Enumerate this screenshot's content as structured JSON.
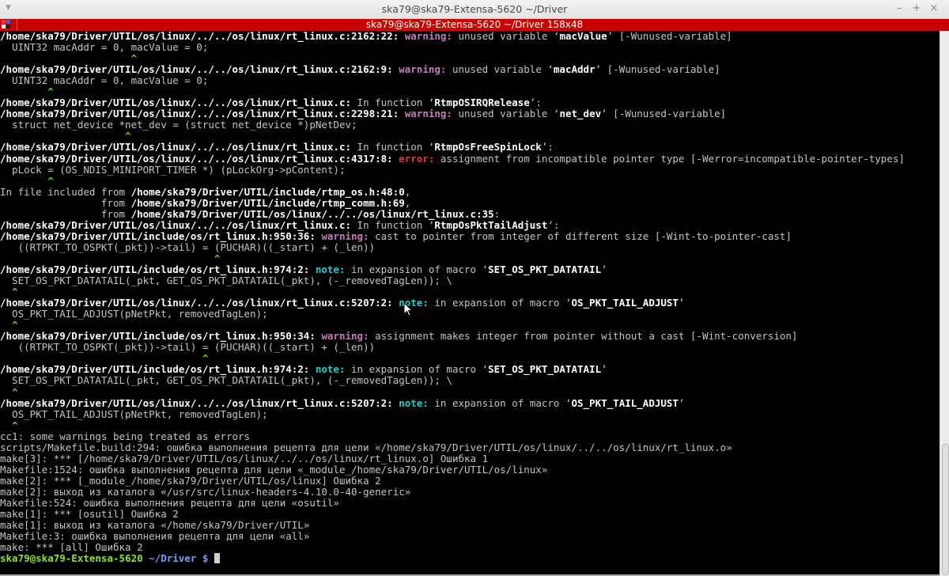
{
  "window": {
    "title": "ska79@ska79-Extensa-5620 ~/Driver",
    "controls": {
      "minimize": "–",
      "maximize": "+",
      "close": "×"
    },
    "menu_icon": "▼"
  },
  "tab": {
    "label": "ska79@ska79-Extensa-5620 ~/Driver 158x48"
  },
  "colors": {
    "tab_bar": "#c80000",
    "warning": "#c27fb7",
    "error": "#e83a3a",
    "note": "#2ccaca",
    "caret": "#6fcf18",
    "prompt_user": "#8ae234",
    "prompt_path": "#7b9ff0"
  },
  "terminal": {
    "lines": [
      [
        [
          "/home/ska79/Driver/UTIL/os/linux/../../os/linux/rt_linux.c:2162:22: ",
          "b"
        ],
        [
          "warning:",
          "w"
        ],
        [
          " unused variable ‘",
          "t"
        ],
        [
          "macValue",
          "b"
        ],
        [
          "’ [-Wunused-variable]",
          "t"
        ]
      ],
      [
        [
          "  UINT32 macAddr = 0, macValue = 0;",
          "t"
        ]
      ],
      [
        [
          "                      ^",
          "c"
        ]
      ],
      [
        [
          "/home/ska79/Driver/UTIL/os/linux/../../os/linux/rt_linux.c:2162:9: ",
          "b"
        ],
        [
          "warning:",
          "w"
        ],
        [
          " unused variable ‘",
          "t"
        ],
        [
          "macAddr",
          "b"
        ],
        [
          "’ [-Wunused-variable]",
          "t"
        ]
      ],
      [
        [
          "  UINT32 macAddr = 0, macValue = 0;",
          "t"
        ]
      ],
      [
        [
          "        ^",
          "c"
        ]
      ],
      [
        [
          "/home/ska79/Driver/UTIL/os/linux/../../os/linux/rt_linux.c:",
          "b"
        ],
        [
          " In function ‘",
          "t"
        ],
        [
          "RtmpOSIRQRelease",
          "b"
        ],
        [
          "’:",
          "t"
        ]
      ],
      [
        [
          "/home/ska79/Driver/UTIL/os/linux/../../os/linux/rt_linux.c:2298:21: ",
          "b"
        ],
        [
          "warning:",
          "w"
        ],
        [
          " unused variable ‘",
          "t"
        ],
        [
          "net_dev",
          "b"
        ],
        [
          "’ [-Wunused-variable]",
          "t"
        ]
      ],
      [
        [
          "  struct net_device *net_dev = (struct net_device *)pNetDev;",
          "t"
        ]
      ],
      [
        [
          "                     ^",
          "c"
        ]
      ],
      [
        [
          "/home/ska79/Driver/UTIL/os/linux/../../os/linux/rt_linux.c:",
          "b"
        ],
        [
          " In function ‘",
          "t"
        ],
        [
          "RtmpOsFreeSpinLock",
          "b"
        ],
        [
          "’:",
          "t"
        ]
      ],
      [
        [
          "/home/ska79/Driver/UTIL/os/linux/../../os/linux/rt_linux.c:4317:8: ",
          "b"
        ],
        [
          "error:",
          "e"
        ],
        [
          " assignment from incompatible pointer type [-Werror=incompatible-pointer-types]",
          "t"
        ]
      ],
      [
        [
          "  pLock = (OS_NDIS_MINIPORT_TIMER *) (pLockOrg->pContent);",
          "t"
        ]
      ],
      [
        [
          "        ^",
          "c"
        ]
      ],
      [
        [
          "In file included from ",
          "t"
        ],
        [
          "/home/ska79/Driver/UTIL/include/rtmp_os.h:48:0",
          "b"
        ],
        [
          ",",
          "t"
        ]
      ],
      [
        [
          "                 from ",
          "t"
        ],
        [
          "/home/ska79/Driver/UTIL/include/rtmp_comm.h:69",
          "b"
        ],
        [
          ",",
          "t"
        ]
      ],
      [
        [
          "                 from ",
          "t"
        ],
        [
          "/home/ska79/Driver/UTIL/os/linux/../../os/linux/rt_linux.c:35",
          "b"
        ],
        [
          ":",
          "t"
        ]
      ],
      [
        [
          "/home/ska79/Driver/UTIL/os/linux/../../os/linux/rt_linux.c:",
          "b"
        ],
        [
          " In function ‘",
          "t"
        ],
        [
          "RtmpOsPktTailAdjust",
          "b"
        ],
        [
          "’:",
          "t"
        ]
      ],
      [
        [
          "/home/ska79/Driver/UTIL/include/os/rt_linux.h:950:36: ",
          "b"
        ],
        [
          "warning:",
          "w"
        ],
        [
          " cast to pointer from integer of different size [-Wint-to-pointer-cast]",
          "t"
        ]
      ],
      [
        [
          "   ((RTPKT_TO_OSPKT(_pkt))->tail) = (PUCHAR)((_start) + (_len))",
          "t"
        ]
      ],
      [
        [
          "                                    ^",
          "c"
        ]
      ],
      [
        [
          "/home/ska79/Driver/UTIL/include/os/rt_linux.h:974:2: ",
          "b"
        ],
        [
          "note:",
          "n"
        ],
        [
          " in expansion of macro ‘",
          "t"
        ],
        [
          "SET_OS_PKT_DATATAIL",
          "b"
        ],
        [
          "’",
          "t"
        ]
      ],
      [
        [
          "  SET_OS_PKT_DATATAIL(_pkt, GET_OS_PKT_DATATAIL(_pkt), (-_removedTagLen)); \\",
          "t"
        ]
      ],
      [
        [
          "  ^",
          "c"
        ]
      ],
      [
        [
          "/home/ska79/Driver/UTIL/os/linux/../../os/linux/rt_linux.c:5207:2: ",
          "b"
        ],
        [
          "note:",
          "n"
        ],
        [
          " in expansion of macro ‘",
          "t"
        ],
        [
          "OS_PKT_TAIL_ADJUST",
          "b"
        ],
        [
          "’",
          "t"
        ]
      ],
      [
        [
          "  OS_PKT_TAIL_ADJUST(pNetPkt, removedTagLen);",
          "t"
        ]
      ],
      [
        [
          "  ^",
          "c"
        ]
      ],
      [
        [
          "/home/ska79/Driver/UTIL/include/os/rt_linux.h:950:34: ",
          "b"
        ],
        [
          "warning:",
          "w"
        ],
        [
          " assignment makes integer from pointer without a cast [-Wint-conversion]",
          "t"
        ]
      ],
      [
        [
          "   ((RTPKT_TO_OSPKT(_pkt))->tail) = (PUCHAR)((_start) + (_len))",
          "t"
        ]
      ],
      [
        [
          "                                  ^",
          "c"
        ]
      ],
      [
        [
          "/home/ska79/Driver/UTIL/include/os/rt_linux.h:974:2: ",
          "b"
        ],
        [
          "note:",
          "n"
        ],
        [
          " in expansion of macro ‘",
          "t"
        ],
        [
          "SET_OS_PKT_DATATAIL",
          "b"
        ],
        [
          "’",
          "t"
        ]
      ],
      [
        [
          "  SET_OS_PKT_DATATAIL(_pkt, GET_OS_PKT_DATATAIL(_pkt), (-_removedTagLen)); \\",
          "t"
        ]
      ],
      [
        [
          "  ^",
          "c"
        ]
      ],
      [
        [
          "/home/ska79/Driver/UTIL/os/linux/../../os/linux/rt_linux.c:5207:2: ",
          "b"
        ],
        [
          "note:",
          "n"
        ],
        [
          " in expansion of macro ‘",
          "t"
        ],
        [
          "OS_PKT_TAIL_ADJUST",
          "b"
        ],
        [
          "’",
          "t"
        ]
      ],
      [
        [
          "  OS_PKT_TAIL_ADJUST(pNetPkt, removedTagLen);",
          "t"
        ]
      ],
      [
        [
          "  ^",
          "c"
        ]
      ],
      [
        [
          "cc1: some warnings being treated as errors",
          "t"
        ]
      ],
      [
        [
          "scripts/Makefile.build:294: ошибка выполнения рецепта для цели «/home/ska79/Driver/UTIL/os/linux/../../os/linux/rt_linux.o»",
          "t"
        ]
      ],
      [
        [
          "make[3]: *** [/home/ska79/Driver/UTIL/os/linux/../../os/linux/rt_linux.o] Ошибка 1",
          "t"
        ]
      ],
      [
        [
          "Makefile:1524: ошибка выполнения рецепта для цели «_module_/home/ska79/Driver/UTIL/os/linux»",
          "t"
        ]
      ],
      [
        [
          "make[2]: *** [_module_/home/ska79/Driver/UTIL/os/linux] Ошибка 2",
          "t"
        ]
      ],
      [
        [
          "make[2]: выход из каталога «/usr/src/linux-headers-4.10.0-40-generic»",
          "t"
        ]
      ],
      [
        [
          "Makefile:524: ошибка выполнения рецепта для цели «osutil»",
          "t"
        ]
      ],
      [
        [
          "make[1]: *** [osutil] Ошибка 2",
          "t"
        ]
      ],
      [
        [
          "make[1]: выход из каталога «/home/ska79/Driver/UTIL»",
          "t"
        ]
      ],
      [
        [
          "Makefile:3: ошибка выполнения рецепта для цели «all»",
          "t"
        ]
      ],
      [
        [
          "make: *** [all] Ошибка 2",
          "t"
        ]
      ]
    ],
    "prompt": {
      "user_host": "ska79@ska79-Extensa-5620",
      "path": " ~/Driver $ "
    }
  }
}
